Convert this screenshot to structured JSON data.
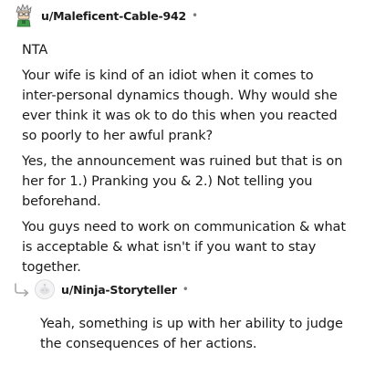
{
  "comment": {
    "username": "u/Maleficent-Cable-942",
    "separator": "•",
    "avatar_icon": "pixel-character-avatar-icon",
    "paragraphs": [
      "NTA",
      "Your wife is kind of an idiot when it comes to inter-personal dynamics though. Why would she ever think it was ok to do this when you reacted so poorly to her awful prank?",
      "Yes, the announcement was ruined but that is on her for 1.) Pranking you & 2.) Not telling you beforehand.",
      "You guys need to work on communication & what is acceptable & what isn't if you want to stay together."
    ]
  },
  "reply": {
    "username": "u/Ninja-Storyteller",
    "separator": "•",
    "avatar_icon": "default-snoo-avatar-icon",
    "arrow_icon": "reply-arrow-icon",
    "text": "Yeah, something is up with her ability to judge the consequences of her actions."
  }
}
